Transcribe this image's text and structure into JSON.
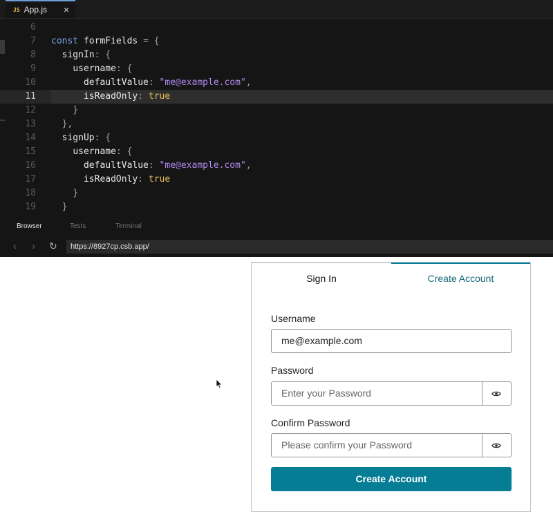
{
  "editor": {
    "tab": {
      "badge": "JS",
      "name": "App.js",
      "close": "×"
    },
    "lines": [
      {
        "n": "6",
        "tokens": []
      },
      {
        "n": "7",
        "tokens": [
          {
            "t": "const ",
            "c": "kw"
          },
          {
            "t": "formFields",
            "c": "key"
          },
          {
            "t": " = {",
            "c": "pun"
          }
        ]
      },
      {
        "n": "8",
        "tokens": [
          {
            "t": "  ",
            "c": "pun"
          },
          {
            "t": "signIn",
            "c": "key"
          },
          {
            "t": ": {",
            "c": "pun"
          }
        ]
      },
      {
        "n": "9",
        "tokens": [
          {
            "t": "    ",
            "c": "pun"
          },
          {
            "t": "username",
            "c": "key"
          },
          {
            "t": ": {",
            "c": "pun"
          }
        ]
      },
      {
        "n": "10",
        "tokens": [
          {
            "t": "      ",
            "c": "pun"
          },
          {
            "t": "defaultValue",
            "c": "key"
          },
          {
            "t": ": ",
            "c": "pun"
          },
          {
            "t": "\"me@example.com\"",
            "c": "str"
          },
          {
            "t": ",",
            "c": "pun"
          }
        ]
      },
      {
        "n": "11",
        "tokens": [
          {
            "t": "      ",
            "c": "pun"
          },
          {
            "t": "isReadOnly",
            "c": "key"
          },
          {
            "t": ": ",
            "c": "pun"
          },
          {
            "t": "true",
            "c": "bool"
          }
        ],
        "active": true
      },
      {
        "n": "12",
        "tokens": [
          {
            "t": "    }",
            "c": "pun"
          }
        ]
      },
      {
        "n": "13",
        "tokens": [
          {
            "t": "  },",
            "c": "pun"
          }
        ]
      },
      {
        "n": "14",
        "tokens": [
          {
            "t": "  ",
            "c": "pun"
          },
          {
            "t": "signUp",
            "c": "key"
          },
          {
            "t": ": {",
            "c": "pun"
          }
        ]
      },
      {
        "n": "15",
        "tokens": [
          {
            "t": "    ",
            "c": "pun"
          },
          {
            "t": "username",
            "c": "key"
          },
          {
            "t": ": {",
            "c": "pun"
          }
        ]
      },
      {
        "n": "16",
        "tokens": [
          {
            "t": "      ",
            "c": "pun"
          },
          {
            "t": "defaultValue",
            "c": "key"
          },
          {
            "t": ": ",
            "c": "pun"
          },
          {
            "t": "\"me@example.com\"",
            "c": "str"
          },
          {
            "t": ",",
            "c": "pun"
          }
        ]
      },
      {
        "n": "17",
        "tokens": [
          {
            "t": "      ",
            "c": "pun"
          },
          {
            "t": "isReadOnly",
            "c": "key"
          },
          {
            "t": ": ",
            "c": "pun"
          },
          {
            "t": "true",
            "c": "bool"
          }
        ]
      },
      {
        "n": "18",
        "tokens": [
          {
            "t": "    }",
            "c": "pun"
          }
        ]
      },
      {
        "n": "19",
        "tokens": [
          {
            "t": "  }",
            "c": "pun"
          }
        ]
      }
    ]
  },
  "panel": {
    "tabs": {
      "browser": "Browser",
      "tests": "Tests",
      "terminal": "Terminal"
    }
  },
  "browser": {
    "back": "‹",
    "forward": "›",
    "reload": "↻",
    "url": "https://8927cp.csb.app/"
  },
  "auth": {
    "tabs": {
      "sign_in": "Sign In",
      "create_account": "Create Account"
    },
    "username": {
      "label": "Username",
      "value": "me@example.com"
    },
    "password": {
      "label": "Password",
      "placeholder": "Enter your Password"
    },
    "confirm": {
      "label": "Confirm Password",
      "placeholder": "Please confirm your Password"
    },
    "submit": "Create Account"
  },
  "colors": {
    "accent": "#047d95",
    "tab_accent_text": "#16697a",
    "editor_bg": "#151515",
    "string": "#b18bf0",
    "boolean": "#e8bf5d",
    "keyword": "#7aa5e0"
  },
  "icons": {
    "password_toggle": "eye-icon",
    "reload": "reload-icon",
    "close": "close-icon",
    "cursor": "mouse-pointer-icon"
  }
}
